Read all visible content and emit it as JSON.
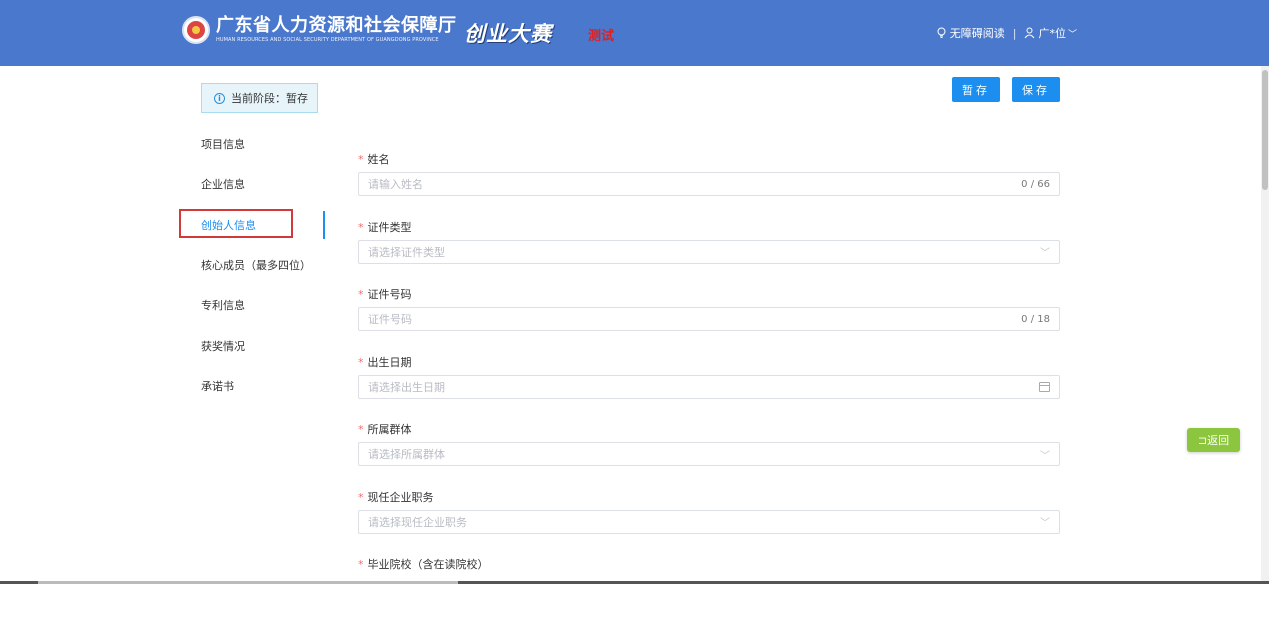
{
  "header": {
    "org_cn": "广东省人力资源和社会保障厅",
    "org_en": "HUMAN RESOURCES AND SOCIAL SECURITY DEPARTMENT OF GUANGDONG PROVINCE",
    "contest_title": "创业大赛",
    "test_tag": "测试",
    "accessibility": "无障碍阅读",
    "user": "广*位",
    "colors": {
      "bar": "#4a78cc",
      "test_tag": "#e02020"
    }
  },
  "stage": {
    "icon": "info-icon",
    "label": "当前阶段：",
    "value": "暂存"
  },
  "actions": {
    "temp_save": "暂存",
    "save": "保存"
  },
  "sidebar": {
    "items": [
      {
        "label": "项目信息"
      },
      {
        "label": "企业信息"
      },
      {
        "label": "创始人信息",
        "active": true
      },
      {
        "label": "核心成员（最多四位）"
      },
      {
        "label": "专利信息"
      },
      {
        "label": "获奖情况"
      },
      {
        "label": "承诺书"
      }
    ]
  },
  "form": {
    "fields": [
      {
        "label": "姓名",
        "required": "*",
        "placeholder": "请输入姓名",
        "counter": "0 / 66"
      },
      {
        "label": "证件类型",
        "required": "*",
        "placeholder": "请选择证件类型",
        "icon": "chevron-down-icon"
      },
      {
        "label": "证件号码",
        "required": "*",
        "placeholder": "证件号码",
        "counter": "0 / 18"
      },
      {
        "label": "出生日期",
        "required": "*",
        "placeholder": "请选择出生日期",
        "icon": "calendar-icon"
      },
      {
        "label": "所属群体",
        "required": "*",
        "placeholder": "请选择所属群体",
        "icon": "chevron-down-icon"
      },
      {
        "label": "现任企业职务",
        "required": "*",
        "placeholder": "请选择现任企业职务",
        "icon": "chevron-down-icon"
      },
      {
        "label": "毕业院校（含在读院校）",
        "required": "*"
      }
    ]
  },
  "back_button": {
    "label": "⊐返回",
    "color": "#8cc63f"
  }
}
